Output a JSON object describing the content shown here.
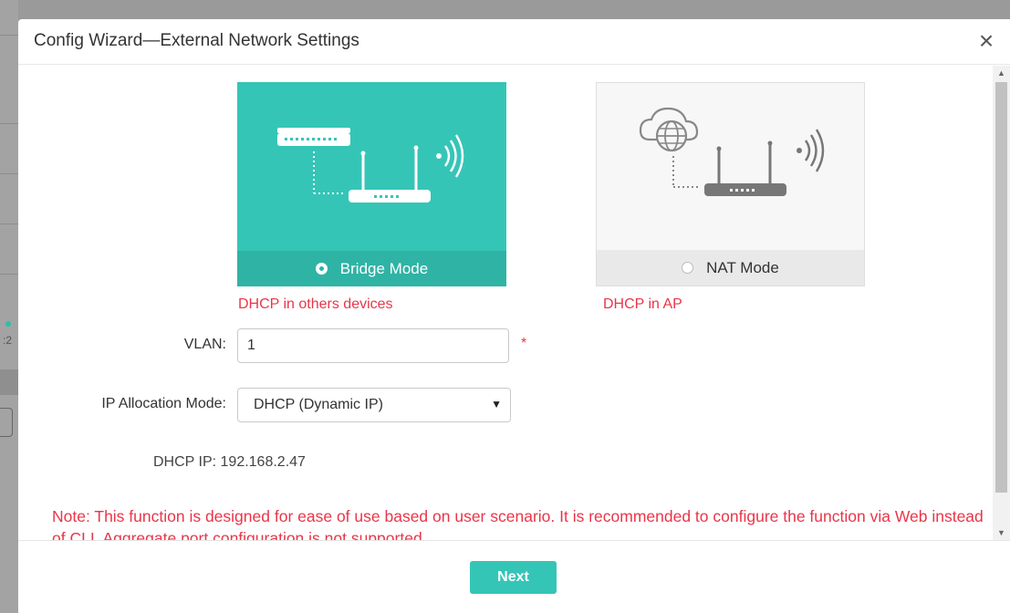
{
  "dialog": {
    "title": "Config Wizard—External Network Settings",
    "close_glyph": "×"
  },
  "modes": [
    {
      "label": "Bridge Mode",
      "description": "DHCP in others devices",
      "selected": true,
      "icon": "switch-router-wifi-icon"
    },
    {
      "label": "NAT Mode",
      "description": "DHCP in AP",
      "selected": false,
      "icon": "cloud-router-wifi-icon"
    }
  ],
  "form": {
    "vlan_label": "VLAN:",
    "vlan_value": "1",
    "required_mark": "*",
    "ip_mode_label": "IP Allocation Mode:",
    "ip_mode_value": "DHCP (Dynamic IP)",
    "dhcp_ip_label": "DHCP IP:",
    "dhcp_ip_value": "192.168.2.47"
  },
  "note": "Note:  This function is designed for ease of use based on user scenario. It is recommended to configure the function via Web instead of CLI. Aggregate port configuration is not supported.",
  "footer": {
    "next_label": "Next"
  },
  "colors": {
    "accent": "#35c5b7",
    "accent_dark": "#2fb3a5",
    "warning": "#e8364a"
  }
}
